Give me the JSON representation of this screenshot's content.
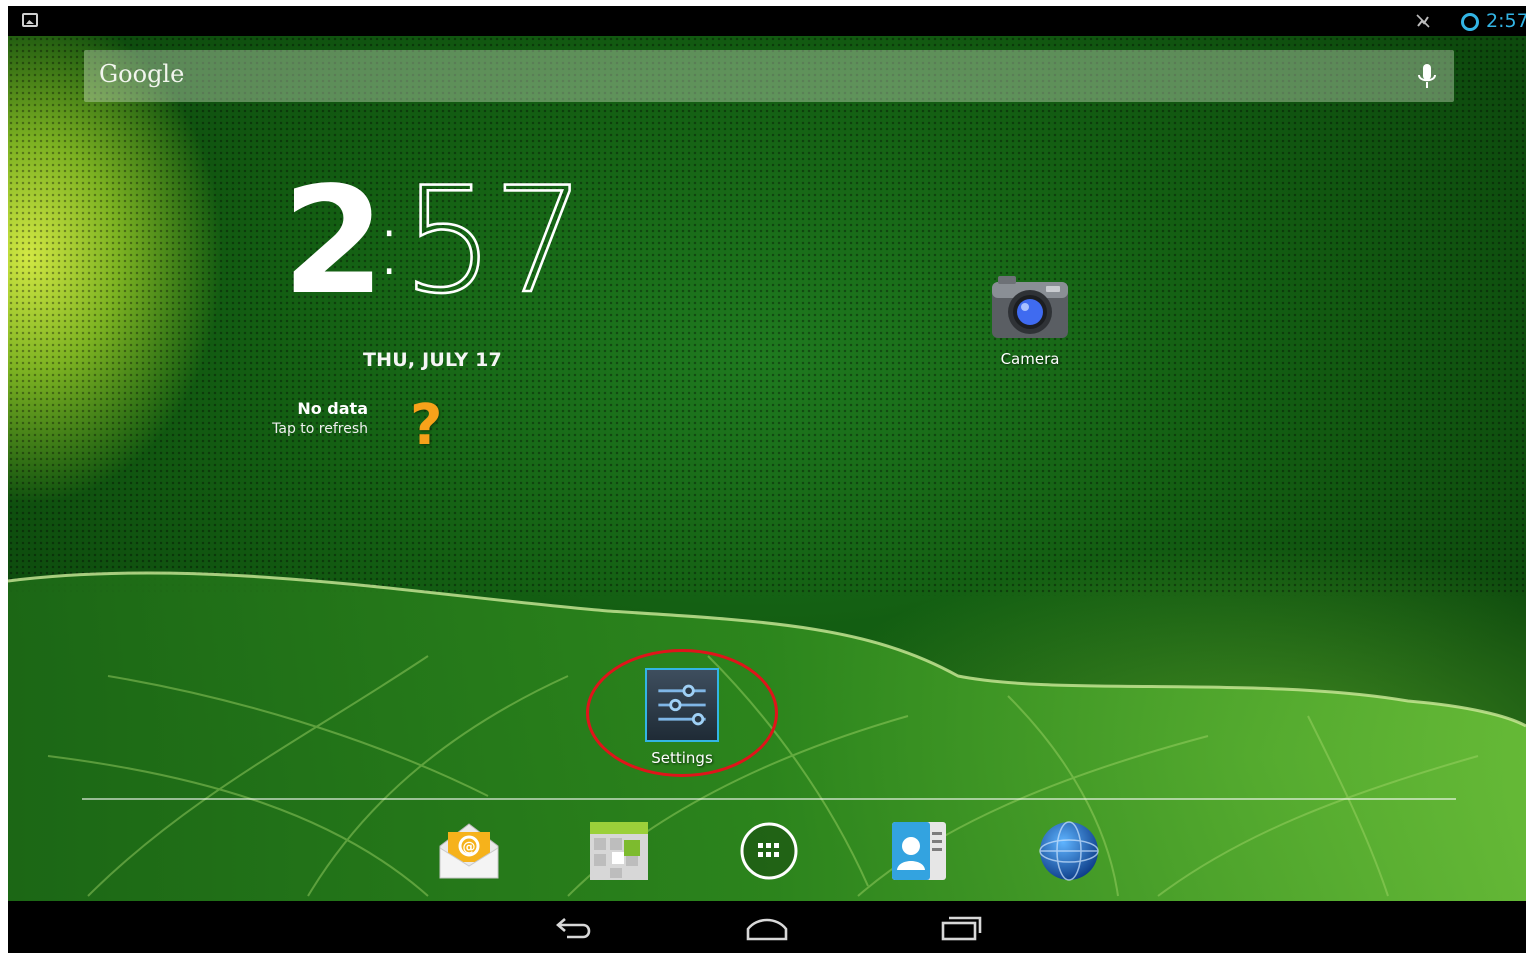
{
  "status_bar": {
    "time": "2:57",
    "icons": [
      "screenshot-icon",
      "mute-icon",
      "sync-icon"
    ],
    "time_color": "#33b5e5"
  },
  "search": {
    "logo": "Google",
    "icons": [
      "mic-icon"
    ]
  },
  "clock_widget": {
    "hour": "2",
    "separator": ":",
    "minutes": "57",
    "date": "THU, JULY 17"
  },
  "weather_widget": {
    "title": "No data",
    "subtitle": "Tap to refresh",
    "icon": "question-mark-icon",
    "icon_glyph": "?",
    "icon_color": "#f7a21a"
  },
  "home_apps": [
    {
      "label": "Camera",
      "icon": "camera-icon"
    },
    {
      "label": "Settings",
      "icon": "settings-icon",
      "highlighted": true,
      "highlight_color": "#e0141a"
    }
  ],
  "dock": {
    "items": [
      "email-icon",
      "gallery-icon",
      "all-apps-icon",
      "contacts-icon",
      "browser-icon"
    ]
  },
  "nav_bar": {
    "buttons": [
      "back-icon",
      "home-icon",
      "recent-apps-icon"
    ]
  }
}
